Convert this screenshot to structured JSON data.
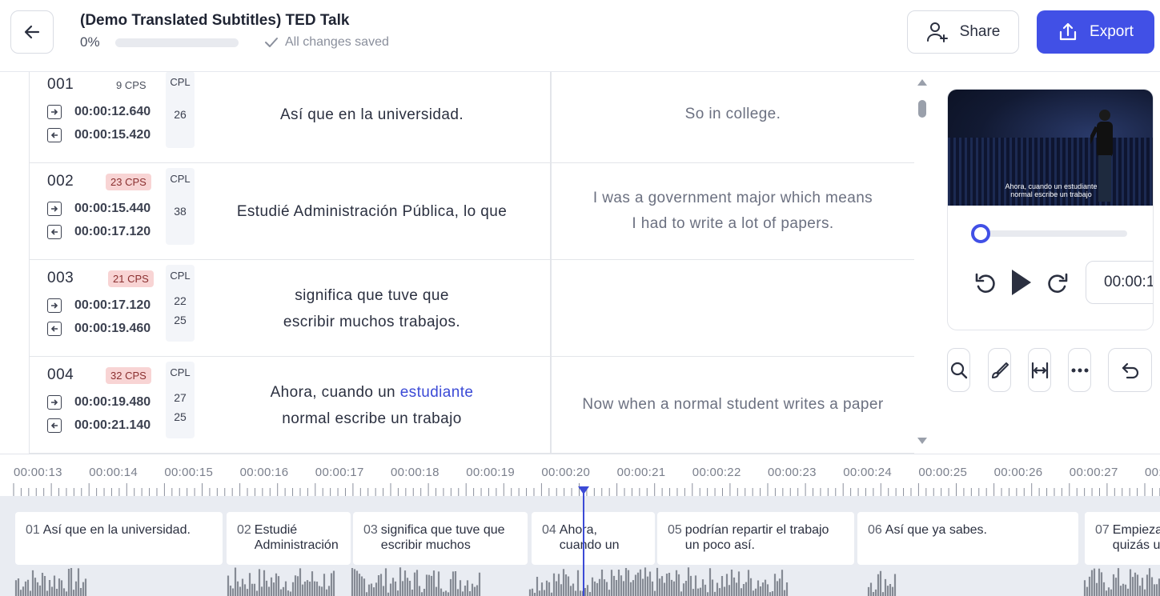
{
  "header": {
    "title": "(Demo Translated Subtitles) TED Talk",
    "progress_label": "0%",
    "progress_value": 0,
    "saved_status": "All changes saved",
    "share_label": "Share",
    "export_label": "Export"
  },
  "colors": {
    "accent": "#4150e6",
    "warn_badge": "#f8d4d4",
    "highlight": "#3b4ad6"
  },
  "rows": [
    {
      "num": "001",
      "cps": "9 CPS",
      "cps_warn": false,
      "cpl_header": "CPL",
      "cpl": [
        "26"
      ],
      "start": "00:00:12.640",
      "end": "00:00:15.420",
      "source": [
        "Así que en la universidad."
      ],
      "target": [
        "So in college."
      ]
    },
    {
      "num": "002",
      "cps": "23 CPS",
      "cps_warn": true,
      "cpl_header": "CPL",
      "cpl": [
        "38"
      ],
      "start": "00:00:15.440",
      "end": "00:00:17.120",
      "source": [
        "Estudié Administración Pública, lo que"
      ],
      "target": [
        "I was a government major which means",
        "I had to write a lot of papers."
      ]
    },
    {
      "num": "003",
      "cps": "21 CPS",
      "cps_warn": true,
      "cpl_header": "CPL",
      "cpl": [
        "22",
        "25"
      ],
      "start": "00:00:17.120",
      "end": "00:00:19.460",
      "source": [
        "significa que tuve que",
        "escribir muchos trabajos."
      ],
      "target": []
    },
    {
      "num": "004",
      "cps": "32 CPS",
      "cps_warn": true,
      "cpl_header": "CPL",
      "cpl": [
        "27",
        "25"
      ],
      "start": "00:00:19.480",
      "end": "00:00:21.140",
      "source_prefix": "Ahora, cuando un ",
      "source_highlight": "estudiante",
      "source_line2": "normal escribe un trabajo",
      "target": [
        "Now when a normal student writes a paper"
      ]
    }
  ],
  "player": {
    "video_subtitle_line1": "Ahora, cuando un estudiante",
    "video_subtitle_line2": "normal escribe un trabajo",
    "seek_fraction": 0,
    "time_display": "00:00:1"
  },
  "tools": [
    "search-icon",
    "brush-icon",
    "split-width-icon",
    "more-icon",
    "undo-icon"
  ],
  "timeline": {
    "labels": [
      "00:00:13",
      "00:00:14",
      "00:00:15",
      "00:00:16",
      "00:00:17",
      "00:00:18",
      "00:00:19",
      "00:00:20",
      "00:00:21",
      "00:00:22",
      "00:00:23",
      "00:00:24",
      "00:00:25",
      "00:00:26",
      "00:00:27",
      "00:"
    ],
    "segments": [
      {
        "n": "01",
        "lines": [
          "Así que en la universidad."
        ]
      },
      {
        "n": "02",
        "lines": [
          "Estudié",
          "Administración"
        ]
      },
      {
        "n": "03",
        "lines": [
          "significa que tuve que",
          "escribir muchos"
        ]
      },
      {
        "n": "04",
        "lines": [
          "Ahora,",
          "cuando un"
        ]
      },
      {
        "n": "05",
        "lines": [
          "podrían repartir el trabajo",
          "un poco así."
        ]
      },
      {
        "n": "06",
        "lines": [
          "Así que ya sabes."
        ]
      },
      {
        "n": "07",
        "lines": [
          "Empieza",
          "quizás u"
        ]
      }
    ]
  }
}
